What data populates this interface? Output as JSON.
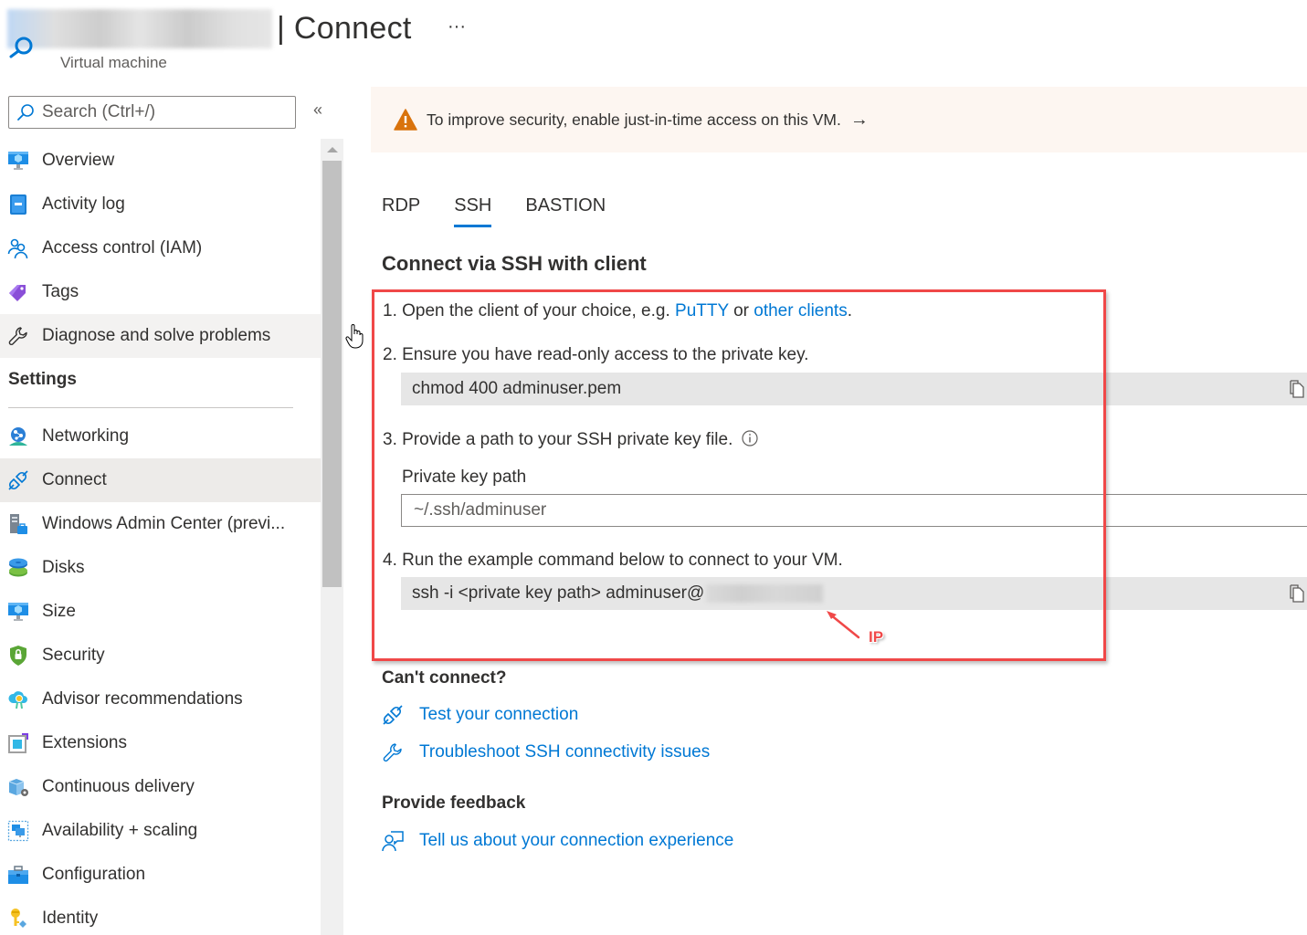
{
  "header": {
    "title": "| Connect",
    "subtitle": "Virtual machine",
    "more_label": "···"
  },
  "sidebar": {
    "search_placeholder": "Search (Ctrl+/)",
    "collapse_label": "«",
    "items_top": [
      {
        "label": "Overview",
        "icon": "vm-monitor-icon"
      },
      {
        "label": "Activity log",
        "icon": "activity-log-icon"
      },
      {
        "label": "Access control (IAM)",
        "icon": "access-control-icon"
      },
      {
        "label": "Tags",
        "icon": "tag-icon"
      },
      {
        "label": "Diagnose and solve problems",
        "icon": "wrench-icon"
      }
    ],
    "section_settings": "Settings",
    "items_settings": [
      {
        "label": "Networking",
        "icon": "networking-icon"
      },
      {
        "label": "Connect",
        "icon": "plug-icon",
        "selected": true
      },
      {
        "label": "Windows Admin Center (previ...",
        "icon": "admin-center-icon"
      },
      {
        "label": "Disks",
        "icon": "disks-icon"
      },
      {
        "label": "Size",
        "icon": "size-monitor-icon"
      },
      {
        "label": "Security",
        "icon": "shield-lock-icon"
      },
      {
        "label": "Advisor recommendations",
        "icon": "advisor-icon"
      },
      {
        "label": "Extensions",
        "icon": "extensions-icon"
      },
      {
        "label": "Continuous delivery",
        "icon": "continuous-delivery-icon"
      },
      {
        "label": "Availability + scaling",
        "icon": "availability-icon"
      },
      {
        "label": "Configuration",
        "icon": "configuration-icon"
      },
      {
        "label": "Identity",
        "icon": "identity-key-icon"
      }
    ]
  },
  "banner": {
    "text": "To improve security, enable just-in-time access on this VM.",
    "arrow": "→"
  },
  "tabs": [
    {
      "label": "RDP",
      "active": false
    },
    {
      "label": "SSH",
      "active": true
    },
    {
      "label": "BASTION",
      "active": false
    }
  ],
  "main": {
    "heading": "Connect via SSH with client",
    "step1": {
      "prefix": "1. Open the client of your choice, e.g. ",
      "link1": "PuTTY",
      "middle": " or ",
      "link2": "other clients",
      "suffix": "."
    },
    "step2": {
      "text": "2. Ensure you have read-only access to the private key.",
      "command": "chmod 400 adminuser.pem"
    },
    "step3": {
      "text": "3. Provide a path to your SSH private key file.",
      "field_label": "Private key path",
      "field_value": "~/.ssh/adminuser"
    },
    "step4": {
      "text": "4. Run the example command below to connect to your VM.",
      "command": "ssh -i <private key path> adminuser@"
    },
    "annotation": "IP"
  },
  "troubleshoot": {
    "heading": "Can't connect?",
    "links": [
      {
        "label": "Test your connection",
        "icon": "plug-icon"
      },
      {
        "label": "Troubleshoot SSH connectivity issues",
        "icon": "wrench-icon"
      }
    ]
  },
  "feedback": {
    "heading": "Provide feedback",
    "link": "Tell us about your connection experience"
  },
  "colors": {
    "accent": "#0078d4",
    "warning": "#d9730d",
    "banner_bg": "#fdf6f1",
    "annotation": "#f04848"
  }
}
